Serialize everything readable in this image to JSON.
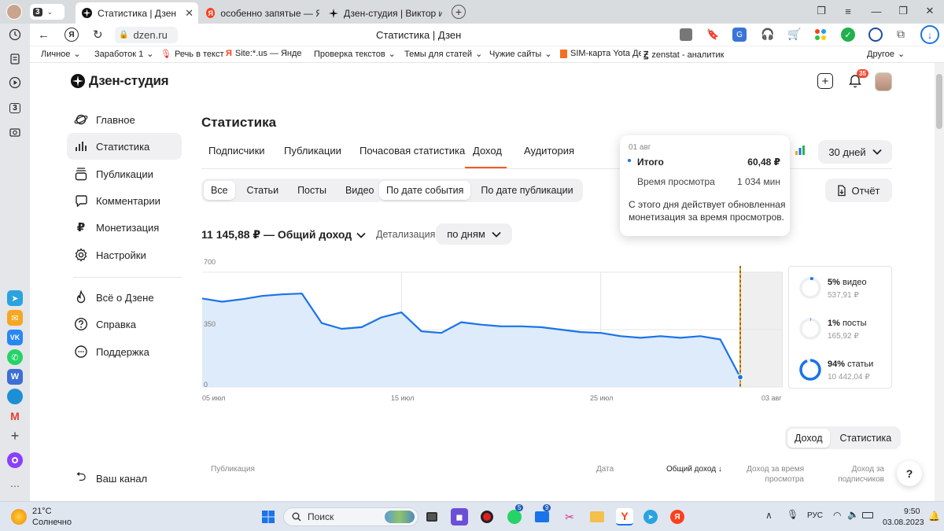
{
  "browser": {
    "tabs": [
      {
        "label": "Статистика | Дзен",
        "active": true
      },
      {
        "label": "особенно запятые — Янд"
      },
      {
        "label": "Дзен-студия | Виктор из П"
      }
    ],
    "tab_counter": "3",
    "address": "dzen.ru",
    "page_title": "Статистика | Дзен",
    "bookmarks": [
      "Личное",
      "Заработок 1",
      "Речь в текст",
      "Site:*.us — Яндекс",
      "Проверка текстов",
      "Темы для статей",
      "Чужие сайты",
      "SIM-карта Yota Де",
      "zenstat - аналитик"
    ],
    "bookmarks_other": "Другое",
    "side_counter": "3"
  },
  "studio": {
    "logo": "Дзен-студия",
    "bell_badge": "35",
    "nav": [
      "Главное",
      "Статистика",
      "Публикации",
      "Комментарии",
      "Монетизация",
      "Настройки"
    ],
    "nav2": [
      "Всё о Дзене",
      "Справка",
      "Поддержка"
    ],
    "my_channel": "Ваш канал",
    "heading": "Статистика",
    "subtabs": [
      "Подписчики",
      "Публикации",
      "Почасовая статистика",
      "Доход",
      "Аудитория"
    ],
    "period": "30 дней",
    "content_filter": [
      "Все",
      "Статьи",
      "Посты",
      "Видео"
    ],
    "date_filter": [
      "По дате события",
      "По дате публикации"
    ],
    "report_label": "Отчёт",
    "total": "11 145,88 ₽ — Общий доход",
    "detail_label": "Детализация",
    "detail_value": "по дням",
    "tooltip": {
      "date": "01 авг",
      "total_label": "Итого",
      "total_value": "60,48 ₽",
      "view_label": "Время просмотра",
      "view_value": "1 034 мин",
      "note": "С этого дня действует обновленная монетизация за время просмотров."
    },
    "breakdown": [
      {
        "pct": "5%",
        "label": "видео",
        "value": "537,91 ₽",
        "fraction": 0.05
      },
      {
        "pct": "1%",
        "label": "посты",
        "value": "165,92 ₽",
        "fraction": 0.01
      },
      {
        "pct": "94%",
        "label": "статьи",
        "value": "10 442,04 ₽",
        "fraction": 0.94
      }
    ],
    "toggle": [
      "Доход",
      "Статистика"
    ],
    "table_headers": [
      "Публикация",
      "Дата",
      "Общий доход",
      "Доход за время просмотра",
      "Доход за подписчиков"
    ],
    "help": "?"
  },
  "chart_data": {
    "type": "area",
    "y_ticks": [
      "700",
      "350",
      "0"
    ],
    "x_ticks": [
      "05 июл",
      "15 июл",
      "25 июл",
      "03 авг"
    ],
    "ylim": [
      0,
      700
    ],
    "x": [
      "05 июл",
      "06 июл",
      "07 июл",
      "08 июл",
      "09 июл",
      "10 июл",
      "11 июл",
      "12 июл",
      "13 июл",
      "14 июл",
      "15 июл",
      "16 июл",
      "17 июл",
      "18 июл",
      "19 июл",
      "20 июл",
      "21 июл",
      "22 июл",
      "23 июл",
      "24 июл",
      "25 июл",
      "26 июл",
      "27 июл",
      "28 июл",
      "29 июл",
      "30 июл",
      "31 июл",
      "01 авг"
    ],
    "series": [
      {
        "values": [
          540,
          520,
          535,
          555,
          565,
          570,
          390,
          355,
          365,
          425,
          455,
          340,
          330,
          395,
          380,
          370,
          370,
          365,
          350,
          335,
          330,
          310,
          300,
          310,
          300,
          310,
          290,
          60
        ]
      }
    ],
    "highlight": "01 авг",
    "color": "#1a73e8"
  },
  "taskbar": {
    "weather_temp": "21°C",
    "weather_text": "Солнечно",
    "search": "Поиск",
    "lang": "РУС",
    "time": "9:50",
    "date": "03.08.2023",
    "badges": [
      "5",
      "9"
    ]
  }
}
